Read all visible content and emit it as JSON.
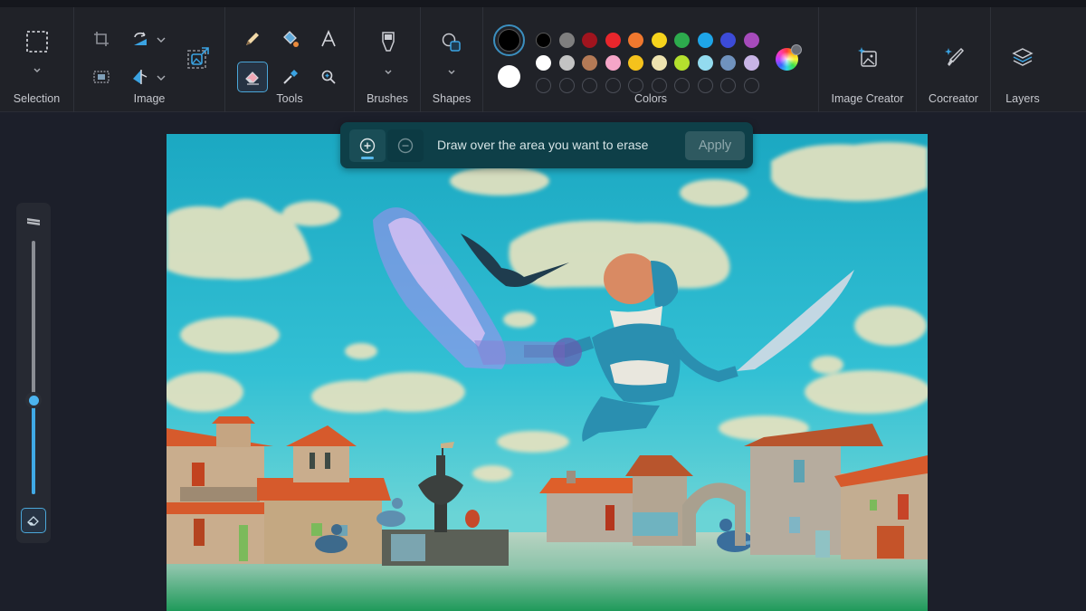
{
  "ribbon": {
    "groups": {
      "selection": "Selection",
      "image": "Image",
      "tools": "Tools",
      "brushes": "Brushes",
      "shapes": "Shapes",
      "colors": "Colors",
      "image_creator": "Image Creator",
      "cocreator": "Cocreator",
      "layers": "Layers"
    },
    "selected_tool": "eraser",
    "icons": {
      "selection": "dashed-rectangle-icon",
      "crop": "crop-icon",
      "resize": "resize-icon",
      "rotate": "rotate-icon",
      "flip": "flip-icon",
      "remove_background": "remove-background-icon",
      "pencil": "pencil-icon",
      "fill": "fill-bucket-icon",
      "text": "text-icon",
      "eraser": "eraser-icon",
      "color_picker": "eyedropper-icon",
      "magnifier": "magnifier-icon",
      "brush": "brush-icon",
      "shapes": "shapes-icon",
      "image_creator": "image-sparkle-icon",
      "cocreator": "brush-sparkle-icon",
      "layers": "layers-icon"
    }
  },
  "colors": {
    "primary": "#000000",
    "secondary": "#ffffff",
    "palette_row1": [
      "#000000",
      "#7f7f7f",
      "#a0141e",
      "#e8262c",
      "#f0782e",
      "#f5d31c",
      "#2dab4d",
      "#1ea5e8",
      "#3c4bd8",
      "#a64bbb"
    ],
    "palette_row2": [
      "#ffffff",
      "#c3c3c3",
      "#b47a56",
      "#f5a6c8",
      "#f5c21c",
      "#eee3b0",
      "#b4e02e",
      "#93dbef",
      "#7092be",
      "#c8b4e6"
    ],
    "custom_slots": 10,
    "edit_colors_icon": "color-wheel-icon"
  },
  "erase_bar": {
    "message": "Draw over the area you want to erase",
    "apply_label": "Apply",
    "add_mode_icon": "plus-circle-icon",
    "remove_mode_icon": "minus-circle-icon",
    "active_mode": "add"
  },
  "size_slider": {
    "value_fraction": 0.37,
    "top_icon": "brush-size-icon",
    "bottom_icon": "eraser-icon"
  },
  "canvas": {
    "description": "Painting of a flying figure in a blue-and-white suit holding a feather quill over a village square with birds and a fountain; a purple erase mask covers the quill in the figure's right hand"
  }
}
